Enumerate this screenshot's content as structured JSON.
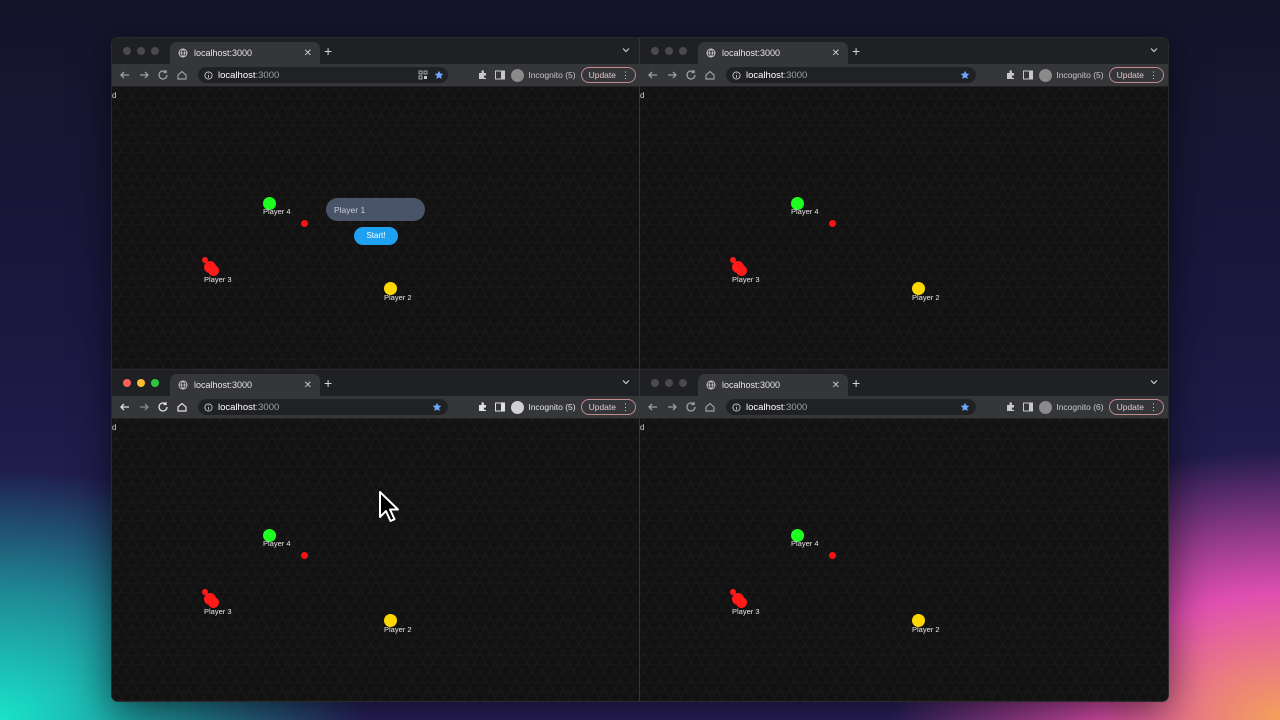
{
  "tab_title": "localhost:3000",
  "url": {
    "host": "localhost",
    "port": ":3000"
  },
  "incognito_labels": [
    "Incognito (5)",
    "Incognito (5)",
    "Incognito (5)",
    "Incognito (6)"
  ],
  "update_label": "Update",
  "new_tab_symbol": "+",
  "close_symbol": "✕",
  "debug_letter": "d",
  "players": {
    "p4": "Player 4",
    "p3": "Player 3",
    "p2": "Player 2"
  },
  "lobby": {
    "name_placeholder": "Player 1",
    "start_label": "Start!"
  },
  "colors": {
    "player4": "#1fff1f",
    "player2": "#ffd700",
    "player3": "#ff1a1a",
    "start_button": "#1ea1f1"
  },
  "icons": [
    "globe-icon",
    "back-icon",
    "forward-icon",
    "reload-icon",
    "home-icon",
    "info-icon",
    "qr-icon",
    "star-icon",
    "extensions-icon",
    "sidepanel-icon",
    "incognito-avatar-icon",
    "menu-dots-icon",
    "cursor-icon"
  ]
}
